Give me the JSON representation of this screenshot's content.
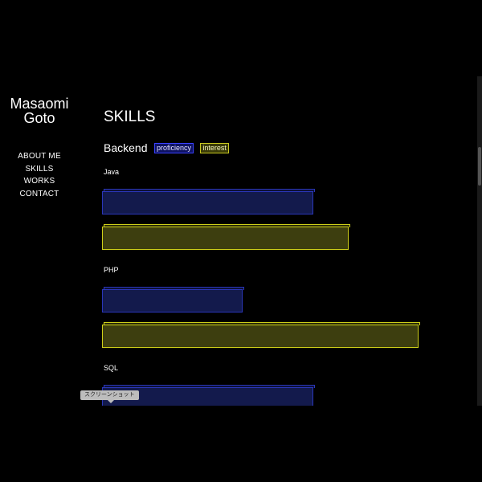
{
  "brand": {
    "line1": "Masaomi",
    "line2": "Goto"
  },
  "nav": [
    "ABOUT ME",
    "SKILLS",
    "WORKS",
    "CONTACT"
  ],
  "page_title": "SKILLS",
  "section": {
    "name": "Backend",
    "legend_proficiency": "proficiency",
    "legend_interest": "interest"
  },
  "skills": [
    {
      "name": "Java",
      "proficiency": 0.6,
      "interest": 0.7
    },
    {
      "name": "PHP",
      "proficiency": 0.4,
      "interest": 0.9
    },
    {
      "name": "SQL",
      "proficiency": 0.6
    }
  ],
  "tooltip": "スクリーンショット",
  "colors": {
    "background": "#000000",
    "proficiency": "#2a36b8",
    "interest": "#cfd019"
  }
}
